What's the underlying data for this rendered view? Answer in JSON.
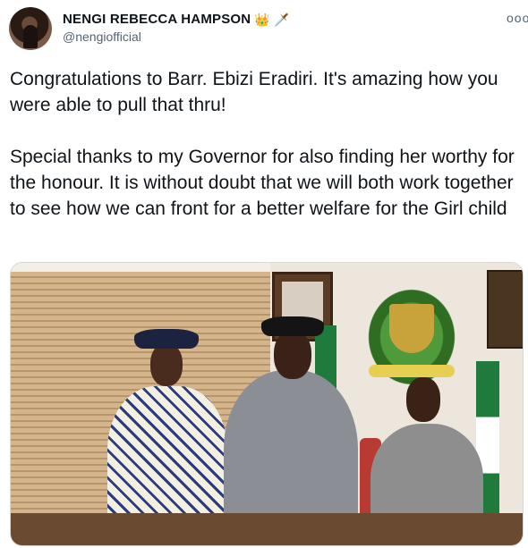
{
  "author": {
    "name": "NENGI REBECCA HAMPSON",
    "badges": [
      "👑",
      "🗡️"
    ],
    "handle": "@nengiofficial"
  },
  "menu": {
    "more_label": "ooo"
  },
  "tweet": {
    "paragraphs": [
      "Congratulations to Barr. Ebizi Eradiri. It's amazing how you were able to pull that thru!",
      "Special thanks to my Governor for also finding her worthy for the honour. It is without doubt that we will both work together to see how we can front for a better welfare for the Girl child"
    ]
  },
  "photo": {
    "description_alt": ""
  }
}
